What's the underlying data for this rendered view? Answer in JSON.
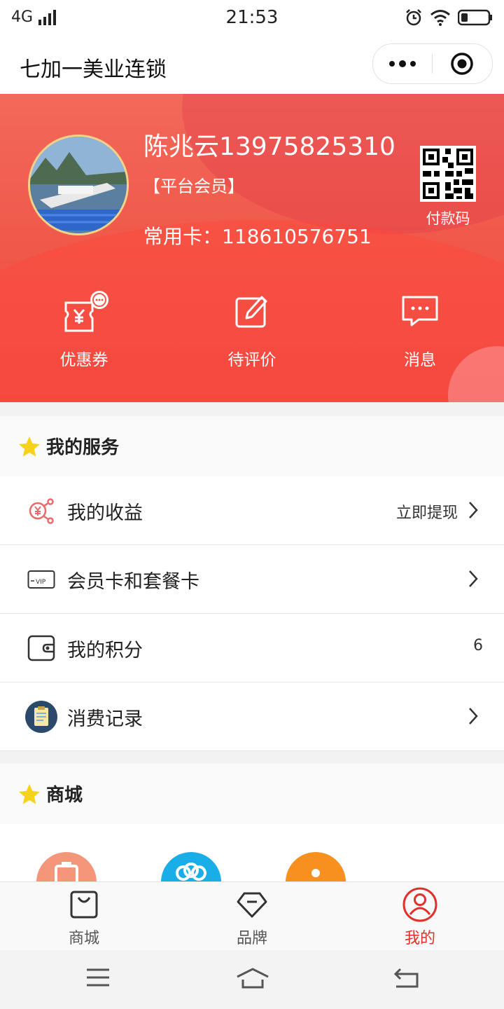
{
  "status_bar": {
    "network": "4G",
    "time": "21:53"
  },
  "app": {
    "title": "七加一美业连锁"
  },
  "profile": {
    "name": "陈兆云13975825310",
    "member_tag": "【平台会员】",
    "card_line": "常用卡：118610576751",
    "pay_code_label": "付款码"
  },
  "quick_actions": [
    {
      "label": "优惠券",
      "icon": "coupon-icon"
    },
    {
      "label": "待评价",
      "icon": "edit-review-icon"
    },
    {
      "label": "消息",
      "icon": "message-icon"
    }
  ],
  "services": {
    "title": "我的服务",
    "items": [
      {
        "label": "我的收益",
        "right_text": "立即提现",
        "icon": "earnings-icon"
      },
      {
        "label": "会员卡和套餐卡",
        "icon": "vip-card-icon"
      },
      {
        "label": "我的积分",
        "count": "6",
        "icon": "wallet-icon"
      },
      {
        "label": "消费记录",
        "icon": "records-icon"
      }
    ]
  },
  "mall": {
    "title": "商城"
  },
  "tabbar": {
    "items": [
      {
        "label": "商城",
        "icon": "shopping-bag-icon"
      },
      {
        "label": "品牌",
        "icon": "diamond-icon"
      },
      {
        "label": "我的",
        "icon": "user-icon",
        "active": true
      }
    ]
  },
  "colors": {
    "accent": "#e0302b",
    "hero": "#f05a4b",
    "star": "#f7d21c"
  }
}
